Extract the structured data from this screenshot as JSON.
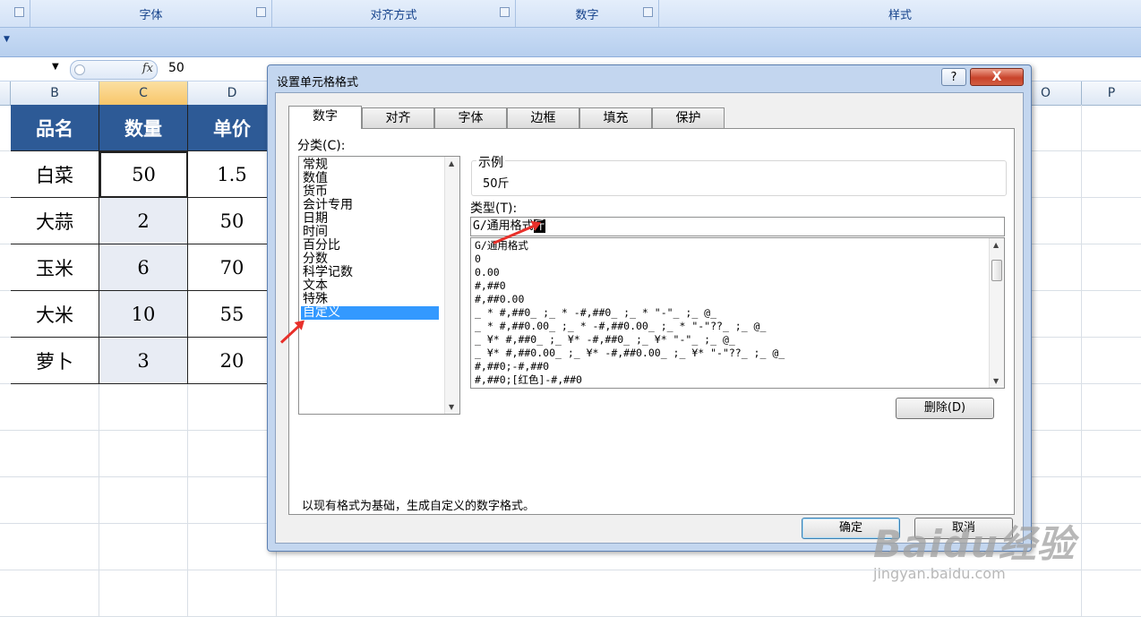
{
  "ribbon": {
    "groups": [
      {
        "label": ""
      },
      {
        "label": "字体"
      },
      {
        "label": "对齐方式"
      },
      {
        "label": "数字"
      },
      {
        "label": "样式"
      }
    ]
  },
  "formula_bar": {
    "fx": "fx",
    "value": "50"
  },
  "columns": [
    "B",
    "C",
    "D",
    "O",
    "P"
  ],
  "table": {
    "headers": [
      "品名",
      "数量",
      "单价"
    ],
    "rows": [
      [
        "白菜",
        "50",
        "1.5"
      ],
      [
        "大蒜",
        "2",
        "50"
      ],
      [
        "玉米",
        "6",
        "70"
      ],
      [
        "大米",
        "10",
        "55"
      ],
      [
        "萝卜",
        "3",
        "20"
      ]
    ]
  },
  "dialog": {
    "title": "设置单元格格式",
    "help": "?",
    "close": "X",
    "tabs": [
      "数字",
      "对齐",
      "字体",
      "边框",
      "填充",
      "保护"
    ],
    "category_label": "分类(C):",
    "categories": [
      "常规",
      "数值",
      "货币",
      "会计专用",
      "日期",
      "时间",
      "百分比",
      "分数",
      "科学记数",
      "文本",
      "特殊",
      "自定义"
    ],
    "selected_category": "自定义",
    "sample_label": "示例",
    "sample_value": "50斤",
    "type_label": "类型(T):",
    "type_value_prefix": "G/通用格式",
    "type_value_highlight": "斤",
    "formats": [
      "G/通用格式",
      "0",
      "0.00",
      "#,##0",
      "#,##0.00",
      "_ * #,##0_ ;_ * -#,##0_ ;_ * \"-\"_ ;_ @_",
      "_ * #,##0.00_ ;_ * -#,##0.00_ ;_ * \"-\"??_ ;_ @_",
      "_ ¥* #,##0_ ;_ ¥* -#,##0_ ;_ ¥* \"-\"_ ;_ @_",
      "_ ¥* #,##0.00_ ;_ ¥* -#,##0.00_ ;_ ¥* \"-\"??_ ;_ @_",
      "#,##0;-#,##0",
      "#,##0;[红色]-#,##0"
    ],
    "delete_button": "删除(D)",
    "description": "以现有格式为基础，生成自定义的数字格式。",
    "ok_button": "确定",
    "cancel_button": "取消"
  },
  "watermark": {
    "main": "Baidu经验",
    "sub": "jingyan.baidu.com"
  },
  "colors": {
    "header_fill": "#2d5a96",
    "selection": "#3399ff",
    "annotation_arrow": "#e8302a"
  }
}
